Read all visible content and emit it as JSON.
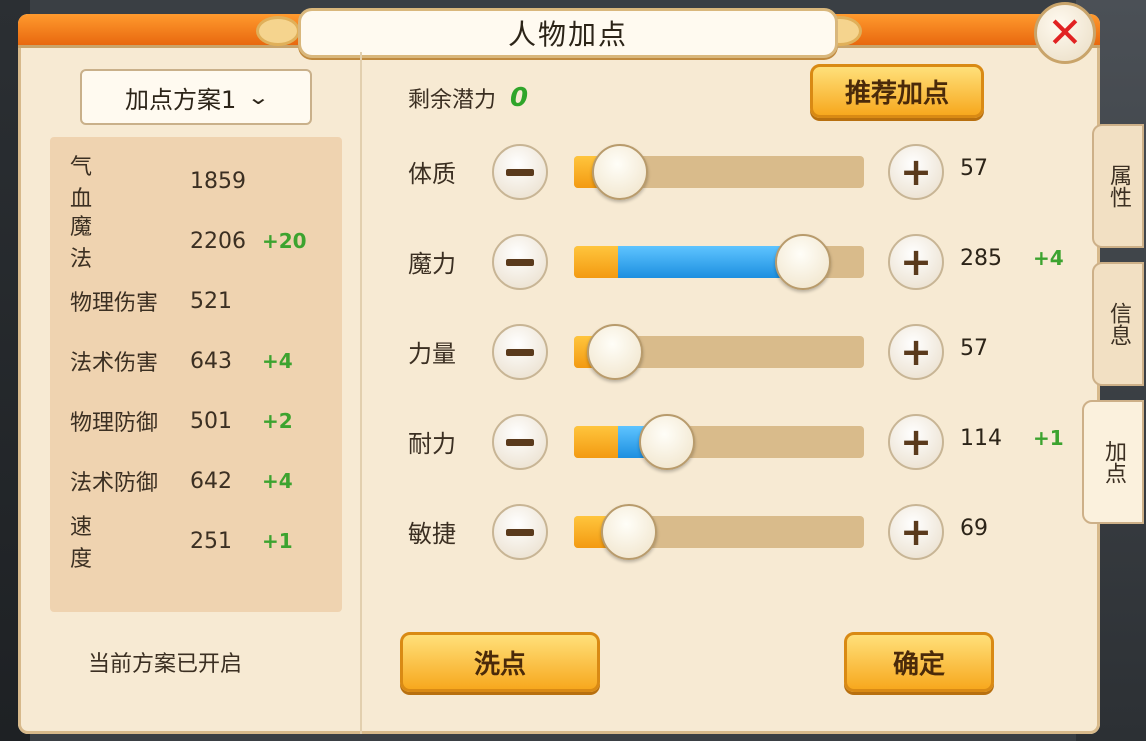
{
  "window": {
    "title": "人物加点",
    "close_label": "✕"
  },
  "scheme": {
    "selected": "加点方案1",
    "status": "当前方案已开启"
  },
  "stats": [
    {
      "label": "气血",
      "value": "1859",
      "bonus": ""
    },
    {
      "label": "魔法",
      "value": "2206",
      "bonus": "+20"
    },
    {
      "label": "物理伤害",
      "value": "521",
      "bonus": ""
    },
    {
      "label": "法术伤害",
      "value": "643",
      "bonus": "+4"
    },
    {
      "label": "物理防御",
      "value": "501",
      "bonus": "+2"
    },
    {
      "label": "法术防御",
      "value": "642",
      "bonus": "+4"
    },
    {
      "label": "速度",
      "value": "251",
      "bonus": "+1"
    }
  ],
  "potential": {
    "label": "剩余潜力",
    "value": "0"
  },
  "recommend_label": "推荐加点",
  "attributes": [
    {
      "label": "体质",
      "value": "57",
      "bonus": "",
      "level": 0.16,
      "added": 0.0
    },
    {
      "label": "魔力",
      "value": "285",
      "bonus": "+4",
      "level": 0.79,
      "added": 0.63
    },
    {
      "label": "力量",
      "value": "57",
      "bonus": "",
      "level": 0.14,
      "added": 0.0
    },
    {
      "label": "耐力",
      "value": "114",
      "bonus": "+1",
      "level": 0.32,
      "added": 0.08
    },
    {
      "label": "敏捷",
      "value": "69",
      "bonus": "",
      "level": 0.19,
      "added": 0.0
    }
  ],
  "wash_label": "洗点",
  "confirm_label": "确定",
  "tabs": [
    {
      "label": "属性",
      "active": false
    },
    {
      "label": "信息",
      "active": false
    },
    {
      "label": "加点",
      "active": true
    }
  ],
  "colors": {
    "title_bar": "#e8680f",
    "panel": "#f7ead3",
    "bonus": "#3ca32f",
    "fill_blue": "#1d8fe0",
    "fill_orange": "#f39a11",
    "close": "#e12222"
  },
  "icons": {
    "close": "close-icon",
    "dropdown": "chevron-down-icon",
    "minus": "minus-icon",
    "plus": "plus-icon"
  }
}
